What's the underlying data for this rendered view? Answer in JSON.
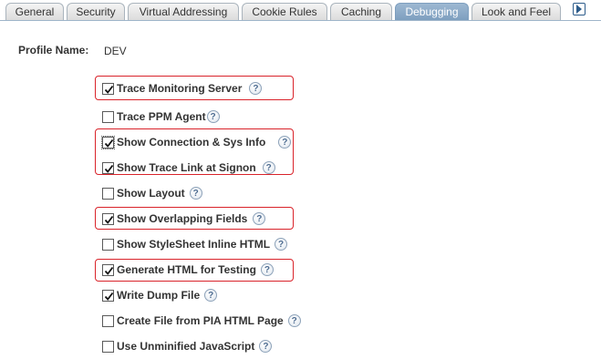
{
  "tabs": [
    {
      "label": "General",
      "active": false
    },
    {
      "label": "Security",
      "active": false
    },
    {
      "label": "Virtual Addressing",
      "active": false
    },
    {
      "label": "Cookie Rules",
      "active": false
    },
    {
      "label": "Caching",
      "active": false
    },
    {
      "label": "Debugging",
      "active": true
    },
    {
      "label": "Look and Feel",
      "active": false
    }
  ],
  "profile": {
    "label": "Profile Name:",
    "value": "DEV"
  },
  "options": [
    {
      "label": "Trace Monitoring Server",
      "checked": true,
      "highlighted": true
    },
    {
      "label": "Trace PPM Agent",
      "checked": false,
      "highlighted": false
    },
    {
      "label": "Show Connection & Sys Info",
      "checked": true,
      "highlighted": true,
      "focused": true
    },
    {
      "label": "Show Trace Link at Signon",
      "checked": true,
      "highlighted": true
    },
    {
      "label": "Show Layout",
      "checked": false,
      "highlighted": false
    },
    {
      "label": "Show Overlapping Fields",
      "checked": true,
      "highlighted": true
    },
    {
      "label": "Show StyleSheet Inline HTML",
      "checked": false,
      "highlighted": false
    },
    {
      "label": "Generate HTML for Testing",
      "checked": true,
      "highlighted": true
    },
    {
      "label": "Write Dump File",
      "checked": true,
      "highlighted": false
    },
    {
      "label": "Create File from PIA HTML Page",
      "checked": false,
      "highlighted": false
    },
    {
      "label": "Use Unminified JavaScript",
      "checked": false,
      "highlighted": false
    }
  ],
  "help_glyph": "?",
  "colors": {
    "active_tab": "#8eabc8",
    "highlight_border": "#d9232a",
    "help_icon": "#4d6c91"
  }
}
